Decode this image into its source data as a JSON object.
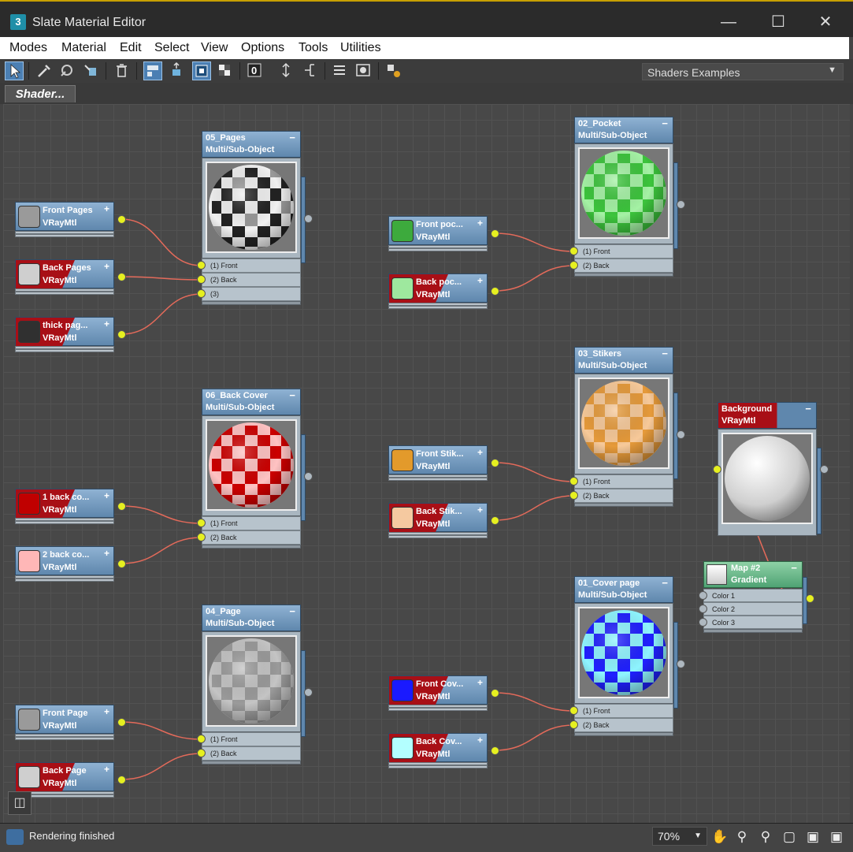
{
  "window": {
    "title": "Slate Material Editor",
    "app_icon_label": "3"
  },
  "menu": [
    "Modes",
    "Material",
    "Edit",
    "Select",
    "View",
    "Options",
    "Tools",
    "Utilities"
  ],
  "view_dropdown": {
    "value": "Shaders Examples"
  },
  "tab": {
    "label": "Shader..."
  },
  "materials": [
    {
      "name": "Front Pages",
      "type": "VRayMtl",
      "swatch": "#9a9a9a",
      "red": false
    },
    {
      "name": "Back Pages",
      "type": "VRayMtl",
      "swatch": "#cfcfcf",
      "red": true
    },
    {
      "name": "thick pag...",
      "type": "VRayMtl",
      "swatch": "#303030",
      "red": true
    },
    {
      "name": "1 back co...",
      "type": "VRayMtl",
      "swatch": "#c00000",
      "red": true
    },
    {
      "name": "2 back co...",
      "type": "VRayMtl",
      "swatch": "#ffb7b7",
      "red": false
    },
    {
      "name": "Front Page",
      "type": "VRayMtl",
      "swatch": "#9a9a9a",
      "red": false
    },
    {
      "name": "Back Page",
      "type": "VRayMtl",
      "swatch": "#cfcfcf",
      "red": true
    },
    {
      "name": "Front poc...",
      "type": "VRayMtl",
      "swatch": "#3daa3d",
      "red": false
    },
    {
      "name": "Back poc...",
      "type": "VRayMtl",
      "swatch": "#9ee89e",
      "red": true
    },
    {
      "name": "Front Stik...",
      "type": "VRayMtl",
      "swatch": "#e39a2b",
      "red": false
    },
    {
      "name": "Back Stik...",
      "type": "VRayMtl",
      "swatch": "#f5c9a0",
      "red": true
    },
    {
      "name": "Front Cov...",
      "type": "VRayMtl",
      "swatch": "#1a1aff",
      "red": true
    },
    {
      "name": "Back Cov...",
      "type": "VRayMtl",
      "swatch": "#b3ffff",
      "red": true
    }
  ],
  "multi_nodes": [
    {
      "name": "05_Pages",
      "type": "Multi/Sub-Object",
      "slots": [
        "(1) Front",
        "(2) Back",
        "(3)"
      ],
      "pattern": {
        "a": "#f0f0f0",
        "b": "#222222",
        "c": "#999999"
      }
    },
    {
      "name": "06_Back Cover",
      "type": "Multi/Sub-Object",
      "slots": [
        "(1) Front",
        "(2) Back"
      ],
      "pattern": {
        "a": "#ffc2c2",
        "b": "#cc0000"
      }
    },
    {
      "name": "04_Page",
      "type": "Multi/Sub-Object",
      "slots": [
        "(1) Front",
        "(2) Back"
      ],
      "pattern": {
        "a": "#c4c4c4",
        "b": "#9a9a9a"
      }
    },
    {
      "name": "02_Pocket",
      "type": "Multi/Sub-Object",
      "slots": [
        "(1) Front",
        "(2) Back"
      ],
      "pattern": {
        "a": "#a4f2a4",
        "b": "#3cc43c"
      }
    },
    {
      "name": "03_Stikers",
      "type": "Multi/Sub-Object",
      "slots": [
        "(1) Front",
        "(2) Back"
      ],
      "pattern": {
        "a": "#f7c999",
        "b": "#e69a3a"
      }
    },
    {
      "name": "01_Cover page",
      "type": "Multi/Sub-Object",
      "slots": [
        "(1) Front",
        "(2) Back"
      ],
      "pattern": {
        "a": "#8ef4ff",
        "b": "#2020ff"
      }
    }
  ],
  "background_node": {
    "name": "Background",
    "type": "VRayMtl"
  },
  "map_node": {
    "name": "Map #2",
    "type": "Gradient",
    "slots": [
      "Color 1",
      "Color 2",
      "Color 3"
    ]
  },
  "status": {
    "text": "Rendering finished",
    "zoom": "70%"
  },
  "icons": [
    "select-arrow-icon",
    "eyedropper-icon",
    "pick-material-icon",
    "put-material-icon",
    "delete-icon",
    "layout-icon",
    "move-children-icon",
    "show-map-icon",
    "show-background-icon",
    "material-id-icon",
    "hide-slots-icon",
    "layout-children-icon",
    "slot-list-icon",
    "render-preview-icon",
    "navigator-icon",
    "pan-icon",
    "zoom-icon",
    "zoom-region-icon",
    "zoom-extents-icon"
  ]
}
